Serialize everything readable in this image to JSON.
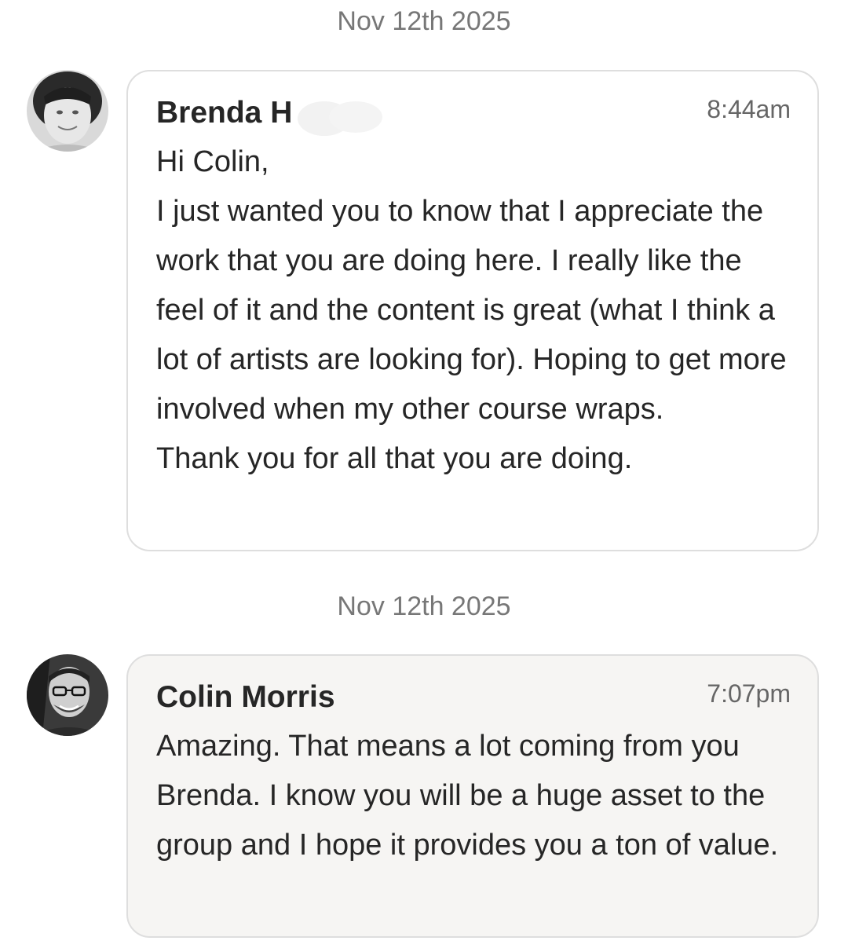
{
  "thread": {
    "messages": [
      {
        "date": "Nov 12th 2025",
        "sender": "Brenda H",
        "time": "8:44am",
        "lines": [
          "Hi Colin,",
          "I just wanted you to know that I appreciate the work that you are doing here. I really like the feel of it and the content is great (what I think a lot of artists are looking for). Hoping to get more involved when my other course wraps.",
          "Thank you for all that you are doing."
        ]
      },
      {
        "date": "Nov 12th 2025",
        "sender": "Colin Morris",
        "time": "7:07pm",
        "lines": [
          "Amazing. That means a lot coming from you Brenda. I know you will be a huge asset to the group and I hope it provides you a ton of value."
        ]
      }
    ]
  },
  "colors": {
    "page_background": "#ffffff",
    "bubble_border": "#dedede",
    "own_bubble_background": "#f6f5f3",
    "date_text": "#777777",
    "time_text": "#666666",
    "body_text": "#262626"
  },
  "icons": {
    "avatar_1": "avatar-photo-woman",
    "avatar_2": "avatar-photo-man-glasses"
  }
}
